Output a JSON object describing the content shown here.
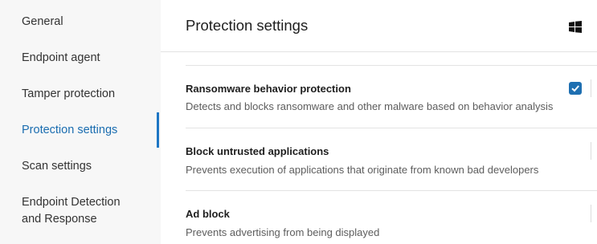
{
  "sidebar": {
    "items": [
      {
        "label": "General"
      },
      {
        "label": "Endpoint agent"
      },
      {
        "label": "Tamper protection"
      },
      {
        "label": "Protection settings"
      },
      {
        "label": "Scan settings"
      },
      {
        "label_line1": "Endpoint Detection",
        "label_line2": "and Response"
      }
    ],
    "active_index": 3
  },
  "header": {
    "title": "Protection settings",
    "os_icon": "windows-icon"
  },
  "settings": [
    {
      "title": "Ransomware behavior protection",
      "description": "Detects and blocks ransomware and other malware based on behavior analysis",
      "checked": true
    },
    {
      "title": "Block untrusted applications",
      "description": "Prevents execution of applications that originate from known bad developers"
    },
    {
      "title": "Ad block",
      "description": "Prevents advertising from being displayed"
    }
  ],
  "colors": {
    "accent": "#1d76c4",
    "checkbox": "#1e6fb1"
  }
}
